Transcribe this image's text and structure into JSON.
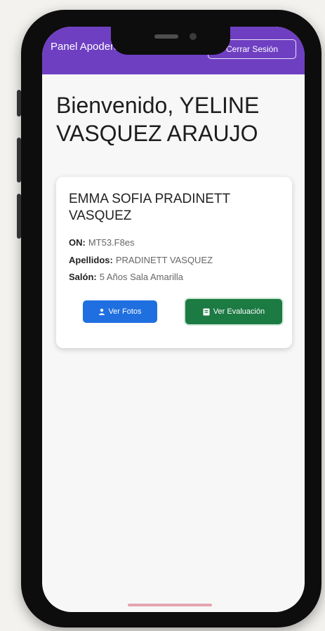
{
  "appbar": {
    "title": "Panel Apoderados",
    "logout_label": "Cerrar Sesión"
  },
  "welcome": "Bienvenido, YELINE VASQUEZ ARAUJO",
  "student": {
    "name": "EMMA SOFIA PRADINETT VASQUEZ",
    "fields": [
      {
        "label": "ON:",
        "value": "MT53.F8es"
      },
      {
        "label": "Apellidos:",
        "value": "PRADINETT VASQUEZ"
      },
      {
        "label": "Salón:",
        "value": "5 Años Sala Amarilla"
      }
    ],
    "photos_button": "Ver Fotos",
    "grades_button": "Ver Evaluación"
  },
  "colors": {
    "appbar": "#6f3fc2",
    "photos_button": "#1f6fe0",
    "grades_button": "#1c7a43"
  },
  "icons": [
    "user-icon",
    "book-icon"
  ]
}
